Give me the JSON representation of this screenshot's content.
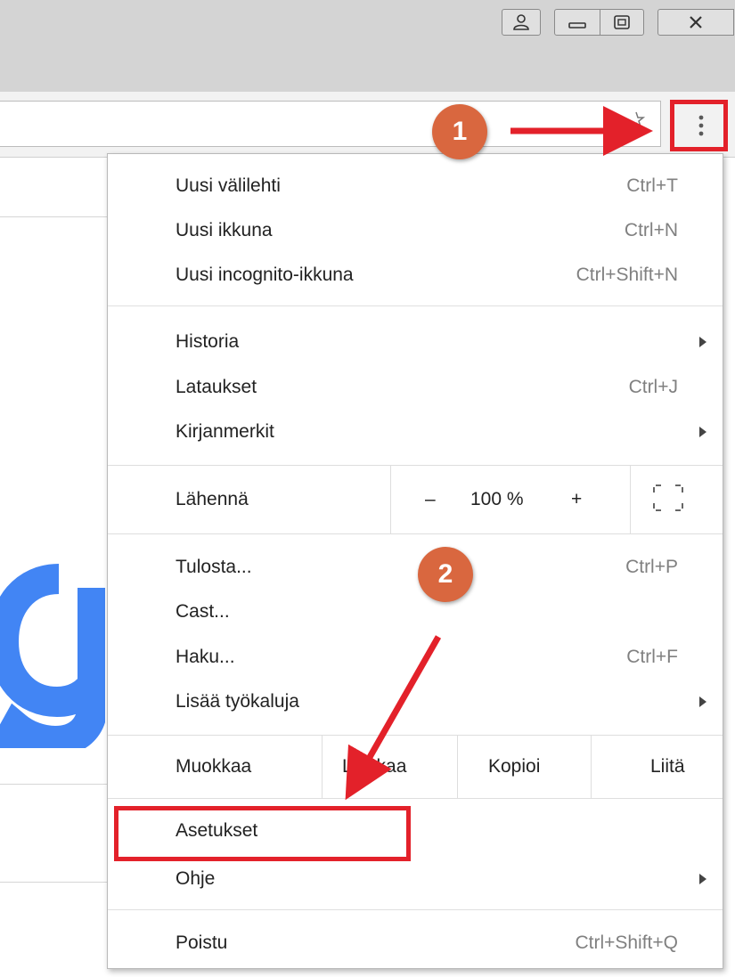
{
  "window": {
    "buttons": [
      "profile",
      "minimize",
      "maximize",
      "close"
    ]
  },
  "menu": {
    "group1": [
      {
        "label": "Uusi välilehti",
        "shortcut": "Ctrl+T"
      },
      {
        "label": "Uusi ikkuna",
        "shortcut": "Ctrl+N"
      },
      {
        "label": "Uusi incognito-ikkuna",
        "shortcut": "Ctrl+Shift+N"
      }
    ],
    "group2": [
      {
        "label": "Historia",
        "submenu": true
      },
      {
        "label": "Lataukset",
        "shortcut": "Ctrl+J"
      },
      {
        "label": "Kirjanmerkit",
        "submenu": true
      }
    ],
    "zoom": {
      "label": "Lähennä",
      "minus": "–",
      "value": "100 %",
      "plus": "+",
      "fullscreen_icon": "fullscreen-icon"
    },
    "group3": [
      {
        "label": "Tulosta...",
        "shortcut": "Ctrl+P"
      },
      {
        "label": "Cast..."
      },
      {
        "label": "Haku...",
        "shortcut": "Ctrl+F"
      },
      {
        "label": "Lisää työkaluja",
        "submenu": true
      }
    ],
    "edit": {
      "label": "Muokkaa",
      "cut": "Leikkaa",
      "copy": "Kopioi",
      "paste": "Liitä"
    },
    "group4": [
      {
        "label": "Asetukset"
      },
      {
        "label": "Ohje",
        "submenu": true
      }
    ],
    "exit": {
      "label": "Poistu",
      "shortcut": "Ctrl+Shift+Q"
    }
  },
  "annotations": {
    "step1": "1",
    "step2": "2",
    "highlight_color": "#e3212a",
    "badge_color": "#d9673f"
  },
  "page": {
    "logo_letter": "g",
    "logo_color": "#4285f4"
  }
}
